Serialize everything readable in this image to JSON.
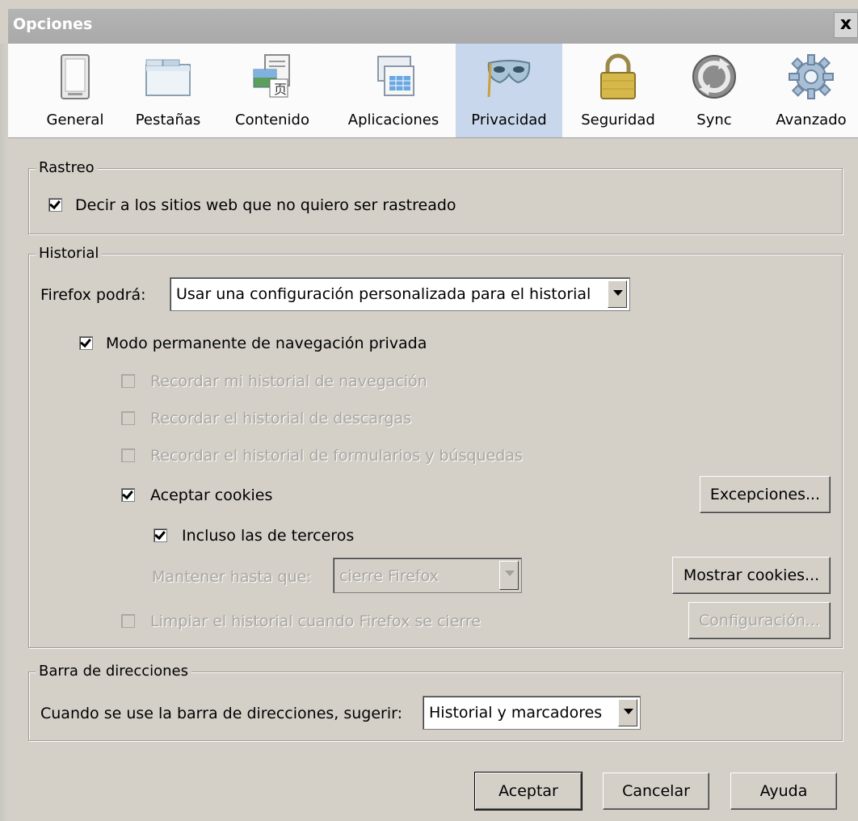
{
  "window": {
    "title": "Opciones",
    "close_label": "x"
  },
  "tabs": [
    {
      "label": "General",
      "icon": "general-icon",
      "active": false
    },
    {
      "label": "Pestañas",
      "icon": "tabs-icon",
      "active": false
    },
    {
      "label": "Contenido",
      "icon": "content-icon",
      "active": false
    },
    {
      "label": "Aplicaciones",
      "icon": "applications-icon",
      "active": false
    },
    {
      "label": "Privacidad",
      "icon": "privacy-mask-icon",
      "active": true
    },
    {
      "label": "Seguridad",
      "icon": "padlock-icon",
      "active": false
    },
    {
      "label": "Sync",
      "icon": "sync-icon",
      "active": false
    },
    {
      "label": "Avanzado",
      "icon": "gear-icon",
      "active": false
    }
  ],
  "tracking": {
    "legend": "Rastreo",
    "dnt_label": "Decir a los sitios web que no quiero ser rastreado",
    "dnt_checked": true
  },
  "history": {
    "legend": "Historial",
    "mode_label": "Firefox podrá:",
    "mode_value": "Usar una configuración personalizada para el historial",
    "private_label": "Modo permanente de navegación privada",
    "private_checked": true,
    "remember_browsing_label": "Recordar mi historial de navegación",
    "remember_downloads_label": "Recordar el historial de descargas",
    "remember_forms_label": "Recordar el historial de formularios y búsquedas",
    "accept_cookies_label": "Aceptar cookies",
    "accept_cookies_checked": true,
    "exceptions_button": "Excepciones...",
    "third_party_label": "Incluso las de terceros",
    "third_party_checked": true,
    "keep_until_label": "Mantener hasta que:",
    "keep_until_value": "cierre Firefox",
    "show_cookies_button": "Mostrar cookies...",
    "clear_on_close_label": "Limpiar el historial cuando Firefox se cierre",
    "settings_button": "Configuración..."
  },
  "location_bar": {
    "legend": "Barra de direcciones",
    "suggest_label": "Cuando se use la barra de direcciones, sugerir:",
    "suggest_value": "Historial y marcadores"
  },
  "buttons": {
    "accept": "Aceptar",
    "cancel": "Cancelar",
    "help": "Ayuda"
  },
  "colors": {
    "dialog_bg": "#d4d0c8",
    "active_tab": "#c9d7ec",
    "titlebar": "#aeaeae",
    "disabled_text": "#a9a6a0"
  }
}
